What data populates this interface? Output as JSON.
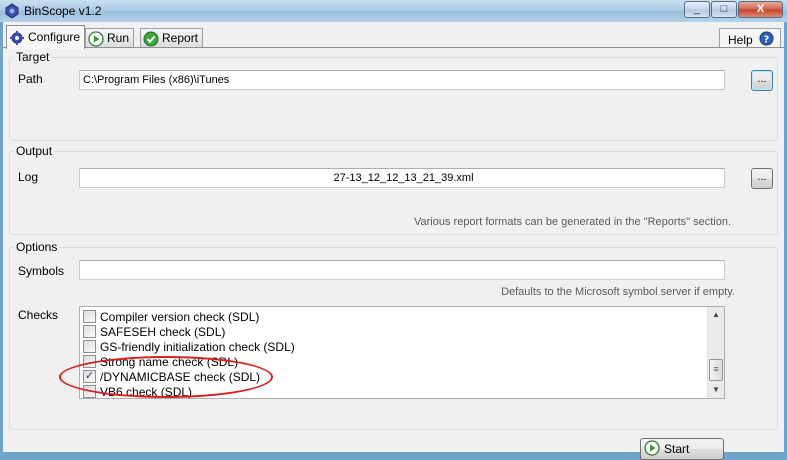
{
  "window": {
    "title": "BinScope v1.2",
    "minimize_glyph": "_",
    "maximize_glyph": "□",
    "close_glyph": "X",
    "accent_color": "#6fa3c8",
    "annotation_color": "#d42020"
  },
  "tabs": [
    {
      "label": "Configure",
      "icon": "gear-icon",
      "active": true
    },
    {
      "label": "Run",
      "icon": "play-icon",
      "active": false
    },
    {
      "label": "Report",
      "icon": "checkmark-icon",
      "active": false
    }
  ],
  "help": {
    "label": "Help",
    "icon": "help-icon"
  },
  "target": {
    "group_label": "Target",
    "path_label": "Path",
    "path_value": "C:\\Program Files (x86)\\iTunes",
    "browse_label": "..."
  },
  "output": {
    "group_label": "Output",
    "log_label": "Log",
    "log_value": "27-13_12_12_13_21_39.xml",
    "browse_label": "...",
    "hint": "Various report formats can be generated in the \"Reports\" section."
  },
  "options": {
    "group_label": "Options",
    "symbols_label": "Symbols",
    "symbols_value": "",
    "symbols_hint": "Defaults to the Microsoft symbol server if empty.",
    "checks_label": "Checks",
    "checks": [
      {
        "label": "Compiler version check (SDL)",
        "checked": false
      },
      {
        "label": "SAFESEH check (SDL)",
        "checked": false
      },
      {
        "label": "GS-friendly initialization check (SDL)",
        "checked": false
      },
      {
        "label": "Strong name check (SDL)",
        "checked": false
      },
      {
        "label": "/DYNAMICBASE check (SDL)",
        "checked": true
      },
      {
        "label": "VB6 check (SDL)",
        "checked": false
      }
    ]
  },
  "start": {
    "label": "Start",
    "icon": "play-icon"
  }
}
